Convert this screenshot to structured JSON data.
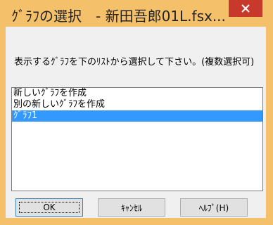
{
  "window": {
    "title": "ｸﾞﾗﾌの選択　- 新田吾郎01L.fsx...",
    "accent_color": "#f5c06a",
    "close_icon": "close-icon"
  },
  "prompt": "表示するｸﾞﾗﾌを下のﾘｽﾄから選択して下さい。(複数選択可)",
  "list": {
    "items": [
      "新しいｸﾞﾗﾌを作成",
      "別の新しいｸﾞﾗﾌを作成",
      "ｸﾞﾗﾌ1"
    ],
    "selected_index": 2
  },
  "buttons": {
    "ok": "OK",
    "cancel": "ｷｬﾝｾﾙ",
    "help": "ﾍﾙﾌﾟ(H)"
  }
}
